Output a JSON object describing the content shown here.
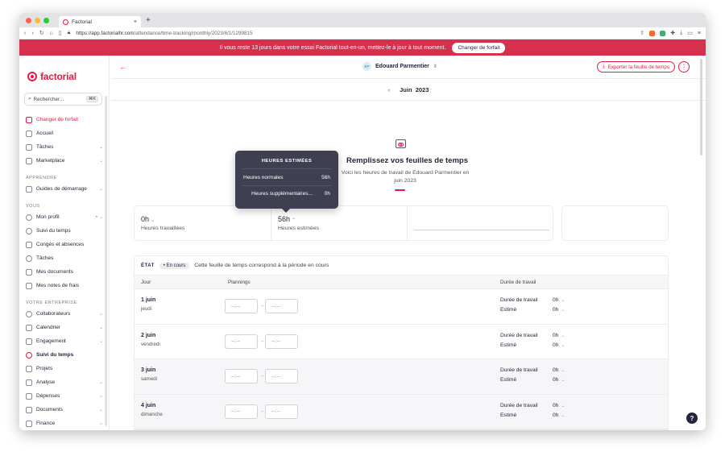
{
  "browser": {
    "tab_title": "Factorial",
    "url_host": "https://app.factorialhr.com",
    "url_path": "/attendance/time-tracking/monthly/2023/6/1/1299815",
    "lights": [
      "#ff5f57",
      "#febc2e",
      "#28c840"
    ]
  },
  "banner": {
    "message": "Il vous reste 13 jours dans votre essai Factorial tout-en-un, mettez-le à jour à tout moment.",
    "button": "Changer de forfait",
    "color": "#d7304e"
  },
  "sidebar": {
    "logo": "factorial",
    "search_placeholder": "Rechercher...",
    "search_shortcut": "⌘K",
    "top_items": [
      {
        "label": "Changer de forfait",
        "icon": "rocket-icon"
      },
      {
        "label": "Accueil",
        "icon": "home-icon"
      },
      {
        "label": "Tâches",
        "icon": "inbox-icon",
        "chevron": true
      },
      {
        "label": "Marketplace",
        "icon": "store-icon",
        "chevron": true
      }
    ],
    "sections": [
      {
        "title": "APPRENDRE",
        "items": [
          {
            "label": "Guides de démarrage",
            "chevron": true
          }
        ]
      },
      {
        "title": "VOUS",
        "items": [
          {
            "label": "Mon profil",
            "chevron": true
          },
          {
            "label": "Suivi du temps"
          },
          {
            "label": "Congés et absences"
          },
          {
            "label": "Tâches"
          },
          {
            "label": "Mes documents"
          },
          {
            "label": "Mes notes de frais"
          }
        ]
      },
      {
        "title": "VOTRE ENTREPRISE",
        "items": [
          {
            "label": "Collaborateurs",
            "chevron": true
          },
          {
            "label": "Calendrier",
            "chevron": true
          },
          {
            "label": "Engagement",
            "chevron": true
          },
          {
            "label": "Suivi du temps",
            "active": true
          },
          {
            "label": "Projets"
          },
          {
            "label": "Analyse",
            "chevron": true
          },
          {
            "label": "Dépenses",
            "chevron": true
          },
          {
            "label": "Documents",
            "chevron": true
          },
          {
            "label": "Finance",
            "chevron": true
          }
        ]
      }
    ]
  },
  "header": {
    "employee_initials": "EP",
    "employee_name": "Edouard Parmentier",
    "export_label": "Exporter la feuille de temps",
    "month": "Juin",
    "year": "2023"
  },
  "hero": {
    "title": "Remplissez vos feuilles de temps",
    "subtitle": "Voici les heures de travail de Edouard Parmentier en juin 2023"
  },
  "stats": [
    {
      "value": "0h",
      "label": "Heures travaillées",
      "caret": "⌄"
    },
    {
      "value": "56h",
      "label": "Heures estimées",
      "caret": "⌃"
    }
  ],
  "tooltip": {
    "title": "HEURES ESTIMÉES",
    "rows": [
      {
        "label": "Heures normales",
        "value": "56h"
      },
      {
        "label": "Heures supplémentaires...",
        "value": "0h"
      }
    ]
  },
  "table": {
    "state_label": "ÉTAT",
    "state_badge": "En cours",
    "state_text": "Cette feuille de temps correspond à la période en cours",
    "columns": {
      "day": "Jour",
      "plannings": "Plannings",
      "duration": "Durée de travail"
    },
    "time_placeholder": "--:--",
    "rows": [
      {
        "day": "1 juin",
        "weekday": "jeudi",
        "duration_label": "Durée de travail",
        "duration": "0h",
        "estimated_label": "Estimé",
        "estimated": "0h"
      },
      {
        "day": "2 juin",
        "weekday": "vendredi",
        "duration_label": "Durée de travail",
        "duration": "0h",
        "estimated_label": "Estimé",
        "estimated": "0h"
      },
      {
        "day": "3 juin",
        "weekday": "samedi",
        "duration_label": "Durée de travail",
        "duration": "0h",
        "estimated_label": "Estimé",
        "estimated": "0h"
      },
      {
        "day": "4 juin",
        "weekday": "dimanche",
        "duration_label": "Durée de travail",
        "duration": "0h",
        "estimated_label": "Estimé",
        "estimated": "0h"
      }
    ]
  },
  "colors": {
    "accent": "#e51943",
    "text": "#25253d"
  }
}
